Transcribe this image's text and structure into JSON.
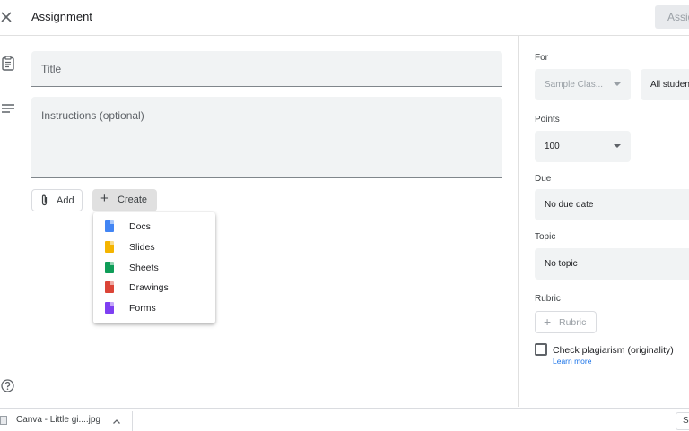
{
  "header": {
    "title": "Assignment",
    "assign_label": "Assign"
  },
  "form": {
    "title_placeholder": "Title",
    "instructions_placeholder": "Instructions (optional)"
  },
  "attach": {
    "add_label": "Add",
    "create_label": "Create"
  },
  "create_menu": [
    {
      "label": "Docs",
      "icon": "google-docs-icon",
      "color": "#4285f4"
    },
    {
      "label": "Slides",
      "icon": "google-slides-icon",
      "color": "#f4b400"
    },
    {
      "label": "Sheets",
      "icon": "google-sheets-icon",
      "color": "#0f9d58"
    },
    {
      "label": "Drawings",
      "icon": "google-drawings-icon",
      "color": "#db4437"
    },
    {
      "label": "Forms",
      "icon": "google-forms-icon",
      "color": "#7e3ff2"
    }
  ],
  "settings": {
    "for_label": "For",
    "class_value": "Sample Clas...",
    "students_value": "All studen",
    "points_label": "Points",
    "points_value": "100",
    "due_label": "Due",
    "due_value": "No due date",
    "topic_label": "Topic",
    "topic_value": "No topic",
    "rubric_label": "Rubric",
    "rubric_button": "Rubric",
    "plagiarism_label": "Check plagiarism (originality)",
    "learn_more": "Learn more"
  },
  "downloads": {
    "file_name": "Canva - Little gi....jpg",
    "show_all": "S"
  }
}
